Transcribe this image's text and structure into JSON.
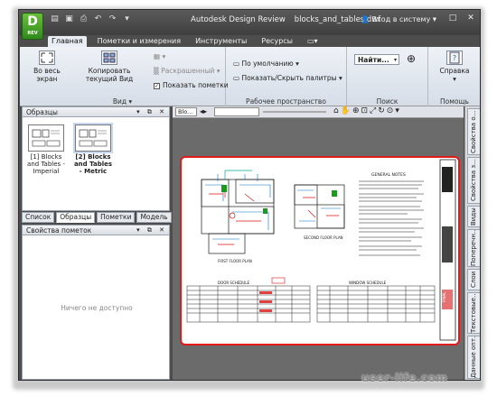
{
  "app": {
    "logo_text": "D",
    "logo_sub": "REV",
    "title": "Autodesk Design Review",
    "document": "blocks_and_tables.dwf",
    "signin": "Вход в систему"
  },
  "tabs": [
    "Главная",
    "Пометки и измерения",
    "Инструменты",
    "Ресурсы"
  ],
  "ribbon": {
    "view": {
      "fit_label": "Во весь экран",
      "copy_label": "Копировать текущий Вид",
      "group_label": "Вид",
      "colorized_label": "Раскрашенный",
      "show_markup_label": "Показать пометки"
    },
    "workspace": {
      "default_label": "По умолчанию",
      "palettes_label": "Показать/Скрыть палитры",
      "group_label": "Рабочее пространство"
    },
    "search": {
      "input_value": "Найти...",
      "group_label": "Поиск"
    },
    "help": {
      "help_label": "Справка",
      "group_label": "Помощь"
    }
  },
  "thumbnails_panel": {
    "title": "Образцы",
    "items": [
      {
        "label": "[1] Blocks and Tables - Imperial",
        "selected": false
      },
      {
        "label": "[2] Blocks and Tables - Metric",
        "selected": true
      }
    ]
  },
  "panel_tabs": [
    "Список",
    "Образцы",
    "Пометки",
    "Модель"
  ],
  "markup_panel": {
    "title": "Свойства пометок",
    "empty_text": "Ничего не доступно"
  },
  "canvas_toolbar": {
    "sheet_label": "Blo..."
  },
  "drawing": {
    "plan1": "FIRST FLOOR PLAN",
    "plan2": "SECOND FLOOR PLAN",
    "notes_title": "GENERAL NOTES",
    "table1": "DOOR SCHEDULE",
    "table2": "WINDOW SCHEDULE",
    "stamp": "FINAL"
  },
  "right_tabs": [
    "Свойства о...",
    "Свойства з...",
    "Виды",
    "Поперечн...",
    "Слои",
    "Текстовые...",
    "Данные опт..."
  ],
  "watermark": "user-life.com",
  "colors": {
    "accent_red": "#e21b1b",
    "titlebar": "#4d4d4d",
    "ribbon": "#e3e8ef"
  }
}
